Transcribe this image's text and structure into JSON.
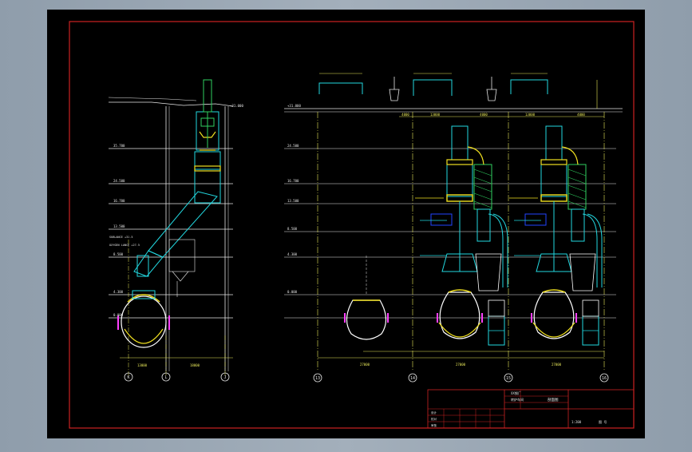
{
  "drawing": {
    "background": "#000000",
    "frame_color": "#cc2222",
    "colors": {
      "structure": "#e6e6e6",
      "dimension": "#e8e85a",
      "equipment_cyan": "#22d8e0",
      "equipment_yellow": "#f0e020",
      "equipment_green": "#30d060",
      "equipment_blue": "#2244ff",
      "equipment_magenta": "#ff40ff",
      "equipment_white": "#ffffff"
    },
    "left_view": {
      "elevations": [
        "35.700",
        "24.500",
        "16.700",
        "13.500",
        "8.500",
        "4.300",
        "0.000"
      ],
      "axis_labels": [
        "K",
        "L",
        "J"
      ],
      "span_dims": [
        "13000",
        "18000"
      ],
      "top_elev": "+31.000",
      "notes": [
        "SUBLANCE +31.5",
        "OXYGEN LANCE +27.5"
      ]
    },
    "right_view": {
      "elevations": [
        "+31.000",
        "24.500",
        "16.700",
        "13.500",
        "8.500",
        "4.300",
        "0.000"
      ],
      "axis_labels": [
        "13",
        "14",
        "15",
        "16"
      ],
      "span_dims": [
        "27000",
        "27000",
        "27000"
      ],
      "sub_dims": [
        "4000",
        "13000",
        "4000",
        "13000",
        "4000"
      ]
    },
    "title_block": {
      "lines": [
        "XX钢厂",
        "转炉车间",
        "剖面图",
        "设计",
        "校对",
        "审核"
      ],
      "sheet": "1:200",
      "number": "图 号"
    }
  }
}
